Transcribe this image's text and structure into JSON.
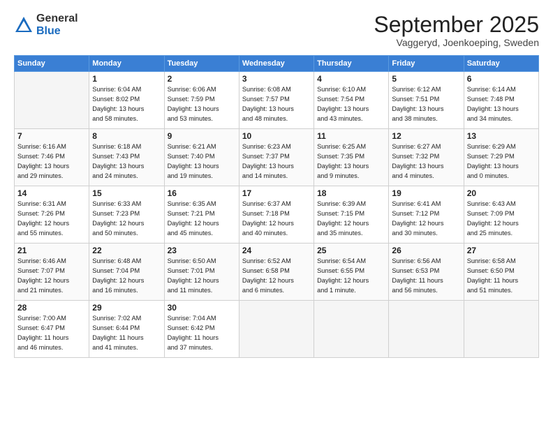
{
  "logo": {
    "general": "General",
    "blue": "Blue"
  },
  "header": {
    "month": "September 2025",
    "location": "Vaggeryd, Joenkoeping, Sweden"
  },
  "days_of_week": [
    "Sunday",
    "Monday",
    "Tuesday",
    "Wednesday",
    "Thursday",
    "Friday",
    "Saturday"
  ],
  "weeks": [
    [
      {
        "day": "",
        "info": ""
      },
      {
        "day": "1",
        "info": "Sunrise: 6:04 AM\nSunset: 8:02 PM\nDaylight: 13 hours\nand 58 minutes."
      },
      {
        "day": "2",
        "info": "Sunrise: 6:06 AM\nSunset: 7:59 PM\nDaylight: 13 hours\nand 53 minutes."
      },
      {
        "day": "3",
        "info": "Sunrise: 6:08 AM\nSunset: 7:57 PM\nDaylight: 13 hours\nand 48 minutes."
      },
      {
        "day": "4",
        "info": "Sunrise: 6:10 AM\nSunset: 7:54 PM\nDaylight: 13 hours\nand 43 minutes."
      },
      {
        "day": "5",
        "info": "Sunrise: 6:12 AM\nSunset: 7:51 PM\nDaylight: 13 hours\nand 38 minutes."
      },
      {
        "day": "6",
        "info": "Sunrise: 6:14 AM\nSunset: 7:48 PM\nDaylight: 13 hours\nand 34 minutes."
      }
    ],
    [
      {
        "day": "7",
        "info": "Sunrise: 6:16 AM\nSunset: 7:46 PM\nDaylight: 13 hours\nand 29 minutes."
      },
      {
        "day": "8",
        "info": "Sunrise: 6:18 AM\nSunset: 7:43 PM\nDaylight: 13 hours\nand 24 minutes."
      },
      {
        "day": "9",
        "info": "Sunrise: 6:21 AM\nSunset: 7:40 PM\nDaylight: 13 hours\nand 19 minutes."
      },
      {
        "day": "10",
        "info": "Sunrise: 6:23 AM\nSunset: 7:37 PM\nDaylight: 13 hours\nand 14 minutes."
      },
      {
        "day": "11",
        "info": "Sunrise: 6:25 AM\nSunset: 7:35 PM\nDaylight: 13 hours\nand 9 minutes."
      },
      {
        "day": "12",
        "info": "Sunrise: 6:27 AM\nSunset: 7:32 PM\nDaylight: 13 hours\nand 4 minutes."
      },
      {
        "day": "13",
        "info": "Sunrise: 6:29 AM\nSunset: 7:29 PM\nDaylight: 13 hours\nand 0 minutes."
      }
    ],
    [
      {
        "day": "14",
        "info": "Sunrise: 6:31 AM\nSunset: 7:26 PM\nDaylight: 12 hours\nand 55 minutes."
      },
      {
        "day": "15",
        "info": "Sunrise: 6:33 AM\nSunset: 7:23 PM\nDaylight: 12 hours\nand 50 minutes."
      },
      {
        "day": "16",
        "info": "Sunrise: 6:35 AM\nSunset: 7:21 PM\nDaylight: 12 hours\nand 45 minutes."
      },
      {
        "day": "17",
        "info": "Sunrise: 6:37 AM\nSunset: 7:18 PM\nDaylight: 12 hours\nand 40 minutes."
      },
      {
        "day": "18",
        "info": "Sunrise: 6:39 AM\nSunset: 7:15 PM\nDaylight: 12 hours\nand 35 minutes."
      },
      {
        "day": "19",
        "info": "Sunrise: 6:41 AM\nSunset: 7:12 PM\nDaylight: 12 hours\nand 30 minutes."
      },
      {
        "day": "20",
        "info": "Sunrise: 6:43 AM\nSunset: 7:09 PM\nDaylight: 12 hours\nand 25 minutes."
      }
    ],
    [
      {
        "day": "21",
        "info": "Sunrise: 6:46 AM\nSunset: 7:07 PM\nDaylight: 12 hours\nand 21 minutes."
      },
      {
        "day": "22",
        "info": "Sunrise: 6:48 AM\nSunset: 7:04 PM\nDaylight: 12 hours\nand 16 minutes."
      },
      {
        "day": "23",
        "info": "Sunrise: 6:50 AM\nSunset: 7:01 PM\nDaylight: 12 hours\nand 11 minutes."
      },
      {
        "day": "24",
        "info": "Sunrise: 6:52 AM\nSunset: 6:58 PM\nDaylight: 12 hours\nand 6 minutes."
      },
      {
        "day": "25",
        "info": "Sunrise: 6:54 AM\nSunset: 6:55 PM\nDaylight: 12 hours\nand 1 minute."
      },
      {
        "day": "26",
        "info": "Sunrise: 6:56 AM\nSunset: 6:53 PM\nDaylight: 11 hours\nand 56 minutes."
      },
      {
        "day": "27",
        "info": "Sunrise: 6:58 AM\nSunset: 6:50 PM\nDaylight: 11 hours\nand 51 minutes."
      }
    ],
    [
      {
        "day": "28",
        "info": "Sunrise: 7:00 AM\nSunset: 6:47 PM\nDaylight: 11 hours\nand 46 minutes."
      },
      {
        "day": "29",
        "info": "Sunrise: 7:02 AM\nSunset: 6:44 PM\nDaylight: 11 hours\nand 41 minutes."
      },
      {
        "day": "30",
        "info": "Sunrise: 7:04 AM\nSunset: 6:42 PM\nDaylight: 11 hours\nand 37 minutes."
      },
      {
        "day": "",
        "info": ""
      },
      {
        "day": "",
        "info": ""
      },
      {
        "day": "",
        "info": ""
      },
      {
        "day": "",
        "info": ""
      }
    ]
  ]
}
